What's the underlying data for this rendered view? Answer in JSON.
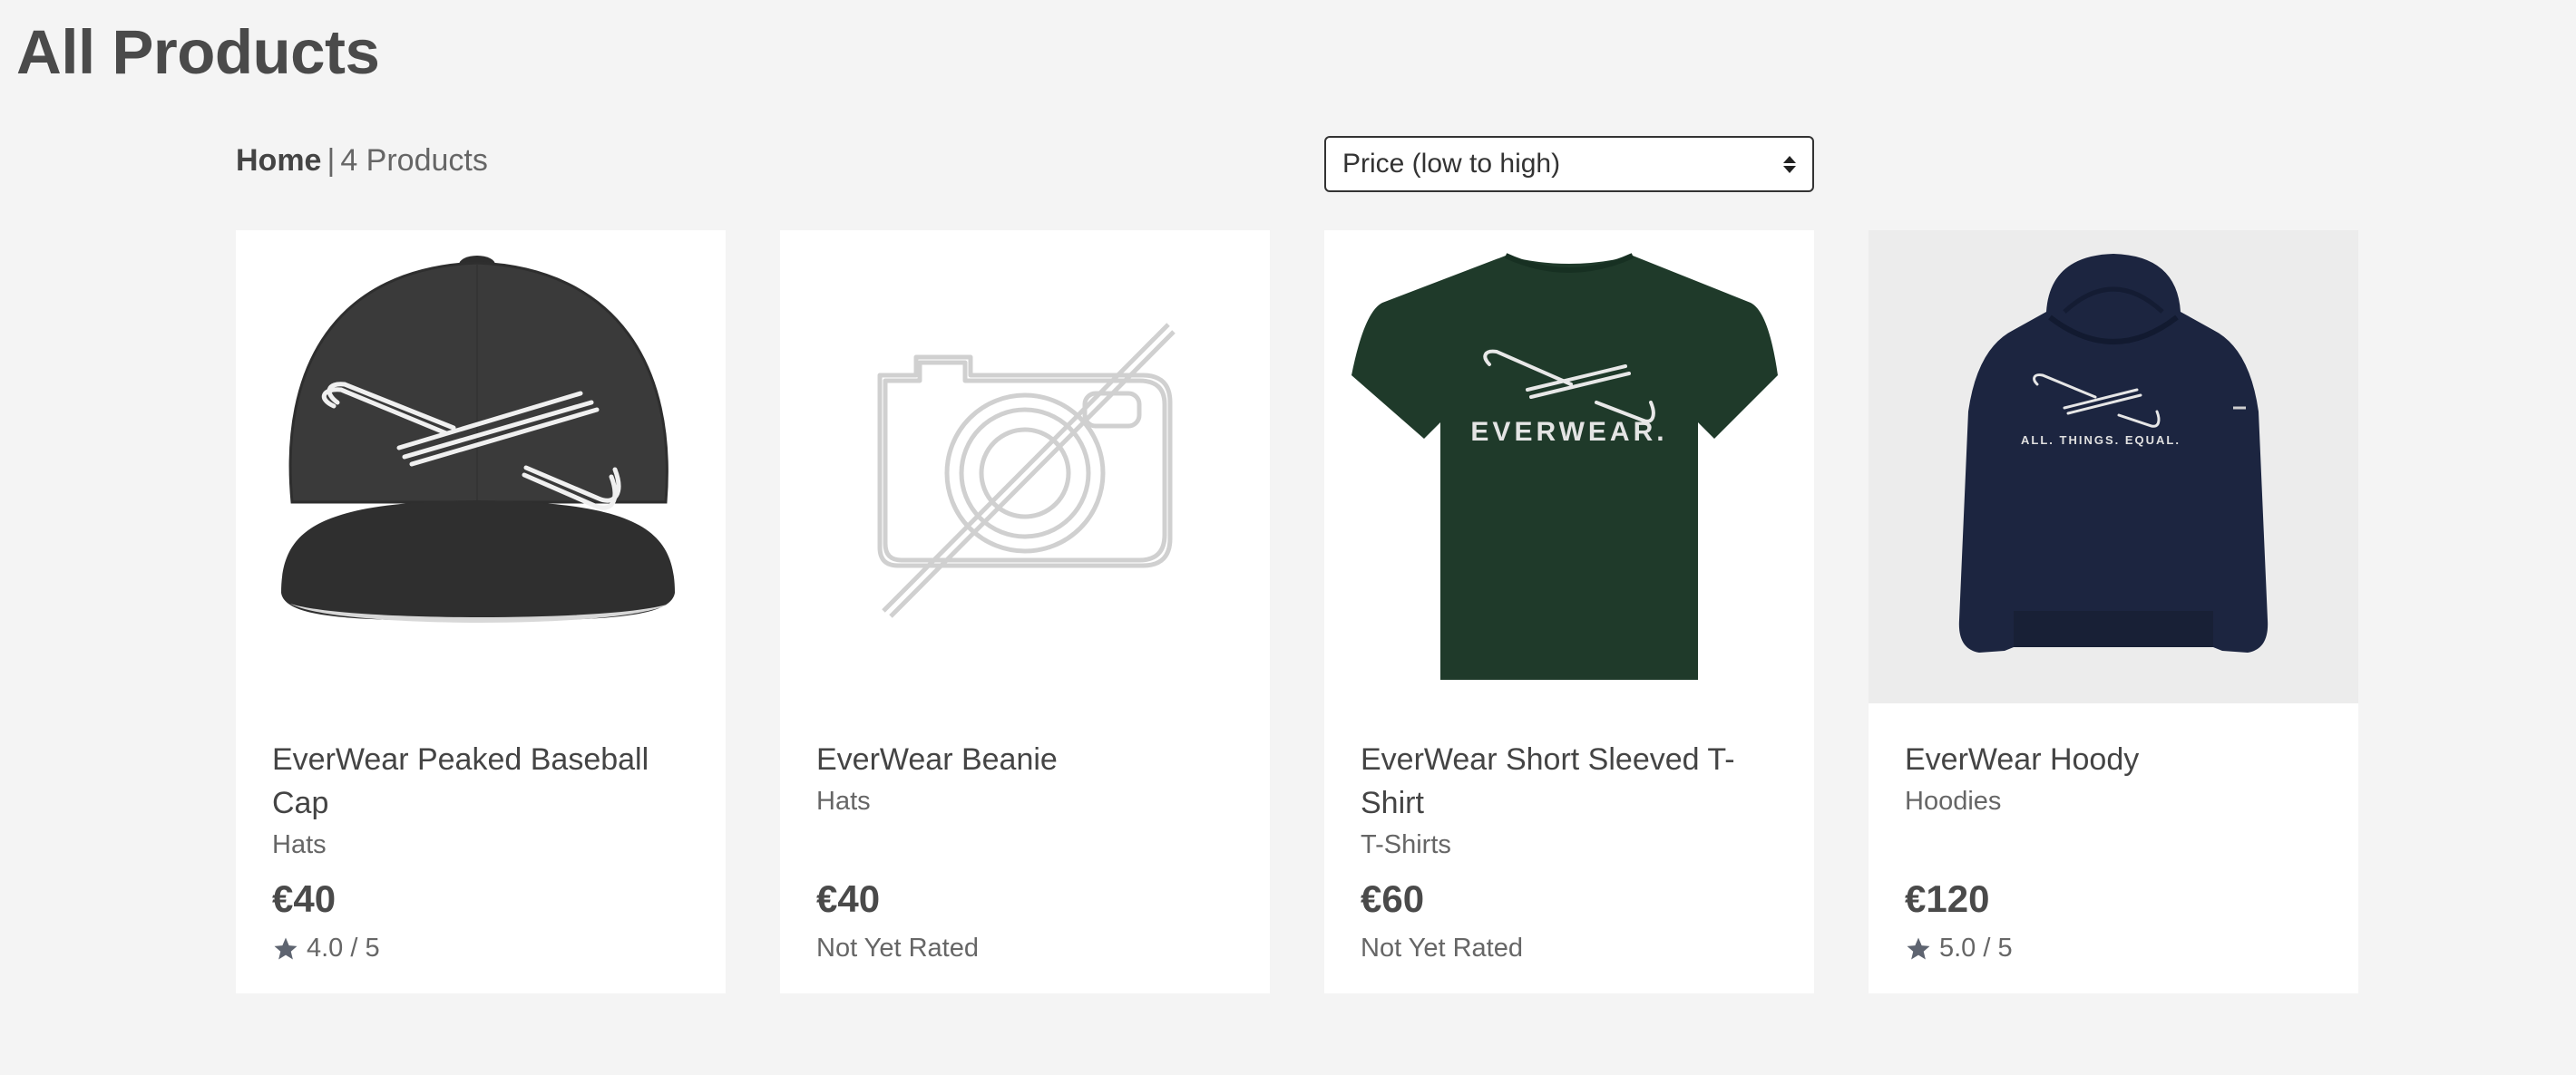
{
  "page": {
    "title": "All Products"
  },
  "breadcrumb": {
    "home": "Home",
    "separator": "|",
    "count": "4 Products"
  },
  "sort": {
    "selected": "Price (low to high)"
  },
  "products": [
    {
      "name": "EverWear Peaked Baseball Cap",
      "category": "Hats",
      "price": "€40",
      "rating": "4.0 / 5",
      "rated": true,
      "image": "baseball-cap"
    },
    {
      "name": "EverWear Beanie",
      "category": "Hats",
      "price": "€40",
      "rating": "Not Yet Rated",
      "rated": false,
      "image": "no-image-placeholder"
    },
    {
      "name": "EverWear Short Sleeved T-Shirt",
      "category": "T-Shirts",
      "price": "€60",
      "rating": "Not Yet Rated",
      "rated": false,
      "image": "t-shirt",
      "logo_text": "EVERWEAR."
    },
    {
      "name": "EverWear Hoody",
      "category": "Hoodies",
      "price": "€120",
      "rating": "5.0 / 5",
      "rated": true,
      "image": "hoodie",
      "logo_text": "ALL. THINGS. EQUAL."
    }
  ],
  "colors": {
    "background": "#f4f4f4",
    "cap": "#3a3a3a",
    "tshirt": "#1f3a2a",
    "hoodie": "#1c2540",
    "text": "#4a4a4a"
  }
}
